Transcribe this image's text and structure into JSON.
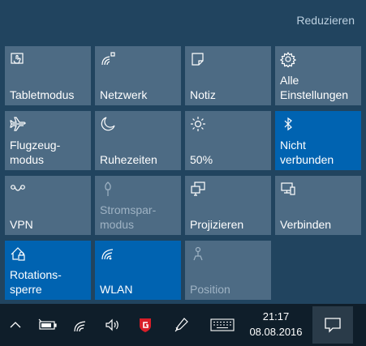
{
  "header": {
    "collapse_label": "Reduzieren"
  },
  "tiles": [
    {
      "label": "Tabletmodus",
      "icon": "tablet-mode-icon",
      "state": "off"
    },
    {
      "label": "Netzwerk",
      "icon": "network-icon",
      "state": "off"
    },
    {
      "label": "Notiz",
      "icon": "note-icon",
      "state": "off"
    },
    {
      "label": "Alle\nEinstellungen",
      "icon": "gear-icon",
      "state": "off"
    },
    {
      "label": "Flugzeug-\nmodus",
      "icon": "airplane-icon",
      "state": "off"
    },
    {
      "label": "Ruhezeiten",
      "icon": "moon-icon",
      "state": "off"
    },
    {
      "label": "50%",
      "icon": "brightness-icon",
      "state": "off"
    },
    {
      "label": "Nicht\nverbunden",
      "icon": "bluetooth-icon",
      "state": "on"
    },
    {
      "label": "VPN",
      "icon": "vpn-icon",
      "state": "off"
    },
    {
      "label": "Stromspar-\nmodus",
      "icon": "battery-saver-icon",
      "state": "disabled"
    },
    {
      "label": "Projizieren",
      "icon": "project-icon",
      "state": "off"
    },
    {
      "label": "Verbinden",
      "icon": "connect-icon",
      "state": "off"
    },
    {
      "label": "Rotations-\nsperre",
      "icon": "rotation-lock-icon",
      "state": "on"
    },
    {
      "label": "WLAN",
      "icon": "wifi-icon",
      "state": "on"
    },
    {
      "label": "Position",
      "icon": "location-icon",
      "state": "disabled"
    }
  ],
  "taskbar": {
    "time": "21:17",
    "date": "08.08.2016",
    "icons": [
      "chevron-up-icon",
      "battery-icon",
      "wifi-icon",
      "volume-icon",
      "gdata-shield-icon",
      "pen-icon",
      "keyboard-icon",
      "notification-icon"
    ]
  },
  "colors": {
    "tile_off": "#4d6b84",
    "tile_on": "#0063b1",
    "panel_bg": "#21445f",
    "taskbar_bg": "#0f1e2a",
    "accent_red": "#d81e28"
  }
}
